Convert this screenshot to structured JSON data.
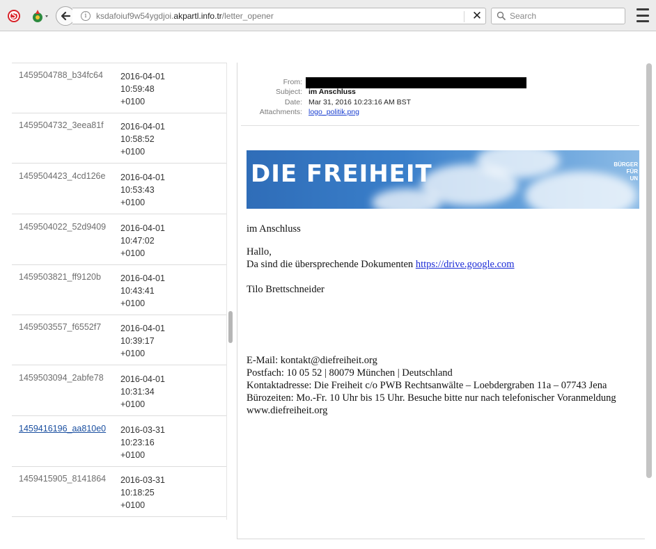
{
  "browser": {
    "url_prefix": "ksdafoiuf9w54ygdjoi.",
    "url_domain": "akpartl.info.tr",
    "url_path": "/letter_opener",
    "search_placeholder": "Search",
    "info_glyph": "i",
    "close_glyph": "✕"
  },
  "messages": [
    {
      "id": "1459504788_b34fc64",
      "date": "2016-04-01\n10:59:48\n+0100"
    },
    {
      "id": "1459504732_3eea81f",
      "date": "2016-04-01\n10:58:52\n+0100"
    },
    {
      "id": "1459504423_4cd126e",
      "date": "2016-04-01\n10:53:43\n+0100"
    },
    {
      "id": "1459504022_52d9409",
      "date": "2016-04-01\n10:47:02\n+0100"
    },
    {
      "id": "1459503821_ff9120b",
      "date": "2016-04-01\n10:43:41\n+0100"
    },
    {
      "id": "1459503557_f6552f7",
      "date": "2016-04-01\n10:39:17\n+0100"
    },
    {
      "id": "1459503094_2abfe78",
      "date": "2016-04-01\n10:31:34\n+0100"
    },
    {
      "id": "1459416196_aa810e0",
      "date": "2016-03-31\n10:23:16\n+0100"
    },
    {
      "id": "1459415905_8141864",
      "date": "2016-03-31\n10:18:25\n+0100"
    }
  ],
  "email": {
    "from_label": "From:",
    "subject_label": "Subject:",
    "subject": "im Anschluss",
    "date_label": "Date:",
    "date": "Mar 31, 2016 10:23:16 AM BST",
    "attachments_label": "Attachments:",
    "attachment": "logo_politik.png",
    "banner_title": "DIE FREIHEIT",
    "banner_side_1": "BÜRGER",
    "banner_side_2": "FÜR",
    "banner_side_3": "UN",
    "body_subject": "im Anschluss",
    "greeting": "Hallo,",
    "line_text": "Da sind die übersprechende Dokumenten ",
    "link": "https://drive.google.com",
    "signature": "Tilo Brettschneider",
    "footer_email": "E-Mail: kontakt@diefreiheit.org",
    "footer_postfach": "Postfach: 10 05 52 | 80079 München | Deutschland",
    "footer_address": "Kontaktadresse: Die Freiheit c/o PWB Rechtsanwälte – Loebdergraben 11a – 07743 Jena",
    "footer_hours": "Bürozeiten: Mo.-Fr. 10 Uhr bis 15 Uhr. Besuche bitte nur nach telefonischer Voranmeldung",
    "footer_web": "www.diefreiheit.org"
  },
  "icons": {
    "ext1": "stop-sign-icon",
    "ext2": "addon-dropdown-icon",
    "back": "back-arrow-icon",
    "menu": "hamburger-menu-icon"
  },
  "colors": {
    "link": "#1a2ad6",
    "banner_blue": "#3a7fca",
    "selected_id": "#1a4fa0"
  }
}
